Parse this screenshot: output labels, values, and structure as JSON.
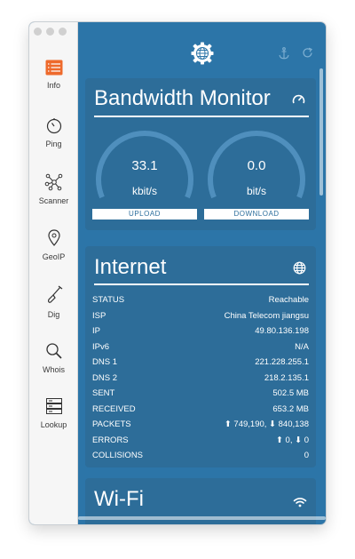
{
  "sidebar": {
    "items": [
      {
        "label": "Info",
        "icon": "info-list-icon"
      },
      {
        "label": "Ping",
        "icon": "stopwatch-icon"
      },
      {
        "label": "Scanner",
        "icon": "network-nodes-icon"
      },
      {
        "label": "GeoIP",
        "icon": "map-pin-icon"
      },
      {
        "label": "Dig",
        "icon": "shovel-icon"
      },
      {
        "label": "Whois",
        "icon": "magnifier-icon"
      },
      {
        "label": "Lookup",
        "icon": "server-stack-icon"
      }
    ]
  },
  "bandwidth": {
    "title": "Bandwidth Monitor",
    "upload": {
      "value": "33.1",
      "unit": "kbit/s",
      "label": "UPLOAD"
    },
    "download": {
      "value": "0.0",
      "unit": "bit/s",
      "label": "DOWNLOAD"
    }
  },
  "internet": {
    "title": "Internet",
    "rows": [
      {
        "key": "STATUS",
        "value": "Reachable"
      },
      {
        "key": "ISP",
        "value": "China Telecom jiangsu"
      },
      {
        "key": "IP",
        "value": "49.80.136.198"
      },
      {
        "key": "IPv6",
        "value": "N/A"
      },
      {
        "key": "DNS 1",
        "value": "221.228.255.1"
      },
      {
        "key": "DNS 2",
        "value": "218.2.135.1"
      },
      {
        "key": "SENT",
        "value": "502.5 MB"
      },
      {
        "key": "RECEIVED",
        "value": "653.2 MB"
      },
      {
        "key": "PACKETS",
        "value": "⬆ 749,190, ⬇ 840,138"
      },
      {
        "key": "ERRORS",
        "value": "⬆ 0, ⬇ 0"
      },
      {
        "key": "COLLISIONS",
        "value": "0"
      }
    ]
  },
  "wifi": {
    "title": "Wi-Fi"
  },
  "colors": {
    "background": "#2c75a8",
    "card": "#2d6d99",
    "sidebar": "#f6f6f6",
    "accent": "#ee6a2c"
  }
}
